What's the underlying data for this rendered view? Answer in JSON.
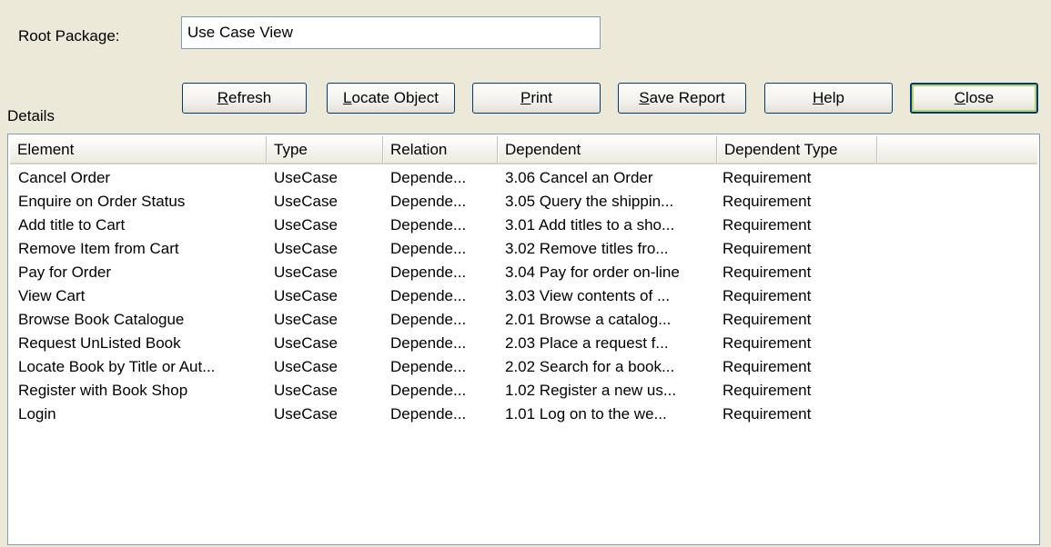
{
  "form": {
    "root_package_label": "Root Package:",
    "root_package_value": "Use Case View",
    "details_label": "Details"
  },
  "buttons": {
    "refresh": {
      "mnemonic": "R",
      "rest": "efresh"
    },
    "locate": {
      "mnemonic": "L",
      "rest": "ocate Object"
    },
    "print": {
      "mnemonic": "P",
      "rest": "rint"
    },
    "save": {
      "mnemonic": "S",
      "rest": "ave Report"
    },
    "help": {
      "mnemonic": "H",
      "rest": "elp"
    },
    "close": {
      "mnemonic": "C",
      "rest": "lose"
    }
  },
  "table": {
    "columns": [
      "Element",
      "Type",
      "Relation",
      "Dependent",
      "Dependent Type",
      ""
    ],
    "rows": [
      [
        "Cancel Order",
        "UseCase",
        "Depende...",
        "3.06 Cancel an Order",
        "Requirement"
      ],
      [
        "Enquire on Order Status",
        "UseCase",
        "Depende...",
        "3.05 Query the shippin...",
        "Requirement"
      ],
      [
        "Add title to Cart",
        "UseCase",
        "Depende...",
        "3.01 Add titles to a sho...",
        "Requirement"
      ],
      [
        "Remove Item from Cart",
        "UseCase",
        "Depende...",
        "3.02 Remove titles fro...",
        "Requirement"
      ],
      [
        "Pay for Order",
        "UseCase",
        "Depende...",
        "3.04 Pay for order on-line",
        "Requirement"
      ],
      [
        "View Cart",
        "UseCase",
        "Depende...",
        "3.03 View contents of ...",
        "Requirement"
      ],
      [
        "Browse Book Catalogue",
        "UseCase",
        "Depende...",
        "2.01 Browse a catalog...",
        "Requirement"
      ],
      [
        "Request UnListed Book",
        "UseCase",
        "Depende...",
        "2.03 Place a request f...",
        "Requirement"
      ],
      [
        "Locate Book by Title or Aut...",
        "UseCase",
        "Depende...",
        "2.02 Search for a book...",
        "Requirement"
      ],
      [
        "Register with Book Shop",
        "UseCase",
        "Depende...",
        "1.02 Register a new us...",
        "Requirement"
      ],
      [
        "Login",
        "UseCase",
        "Depende...",
        "1.01 Log on to the we...",
        "Requirement"
      ]
    ]
  }
}
